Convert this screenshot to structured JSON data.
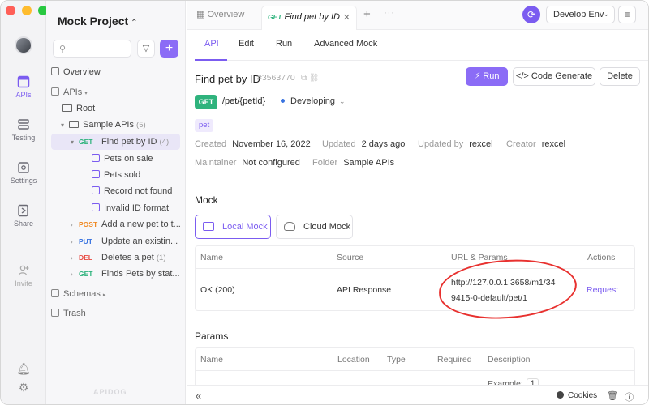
{
  "rail": {
    "apis": "APIs",
    "testing": "Testing",
    "settings": "Settings",
    "share": "Share",
    "invite": "Invite"
  },
  "sidebar": {
    "project_title": "Mock Project",
    "overview": "Overview",
    "apis": "APIs",
    "root": "Root",
    "folder": {
      "label": "Sample APIs",
      "count": "(5)"
    },
    "selected_item": {
      "method": "GET",
      "label": "Find pet by ID",
      "count": "(4)"
    },
    "mocks": [
      "Pets on sale",
      "Pets sold",
      "Record not found",
      "Invalid ID format"
    ],
    "endpoints": [
      {
        "method": "POST",
        "label": "Add a new pet to t..."
      },
      {
        "method": "PUT",
        "label": "Update an existin..."
      },
      {
        "method": "DEL",
        "label": "Deletes a pet",
        "count": "(1)"
      },
      {
        "method": "GET",
        "label": "Finds Pets by stat..."
      }
    ],
    "schemas": "Schemas",
    "trash": "Trash",
    "watermark": "APIDOG"
  },
  "topbar": {
    "overview_tab": "Overview",
    "active_tab": {
      "method": "GET",
      "label": "Find pet by ID"
    },
    "env": "Develop Env"
  },
  "subtabs": [
    "API",
    "Edit",
    "Run",
    "Advanced Mock"
  ],
  "api": {
    "title": "Find pet by ID",
    "id": "#3563770",
    "run": "Run",
    "code_generate": "Code Generate",
    "delete": "Delete",
    "method": "GET",
    "path": "/pet/{petId}",
    "status": "Developing",
    "tag": "pet",
    "created_label": "Created",
    "created": "November 16, 2022",
    "updated_label": "Updated",
    "updated": "2 days ago",
    "updated_by_label": "Updated by",
    "updated_by": "rexcel",
    "creator_label": "Creator",
    "creator": "rexcel",
    "maintainer_label": "Maintainer",
    "maintainer": "Not configured",
    "folder_label": "Folder",
    "folder": "Sample APIs"
  },
  "mock": {
    "title": "Mock",
    "local": "Local Mock",
    "cloud": "Cloud Mock",
    "headers": [
      "Name",
      "Source",
      "URL & Params",
      "Actions"
    ],
    "row": {
      "name": "OK (200)",
      "source": "API Response",
      "url_line1": "http://127.0.0.1:3658/m1/34",
      "url_line2": "9415-0-default/pet/1",
      "action": "Request"
    }
  },
  "params": {
    "title": "Params",
    "headers": [
      "Name",
      "Location",
      "Type",
      "Required",
      "Description"
    ],
    "example_label": "Example:",
    "example_value": "1"
  },
  "bottombar": {
    "cookies": "Cookies"
  },
  "colors": {
    "accent": "#7b5cf0",
    "get": "#2fb37d",
    "post": "#f08a24",
    "put": "#3a74e0",
    "delete": "#e8473e",
    "annotation": "#e8312f"
  }
}
